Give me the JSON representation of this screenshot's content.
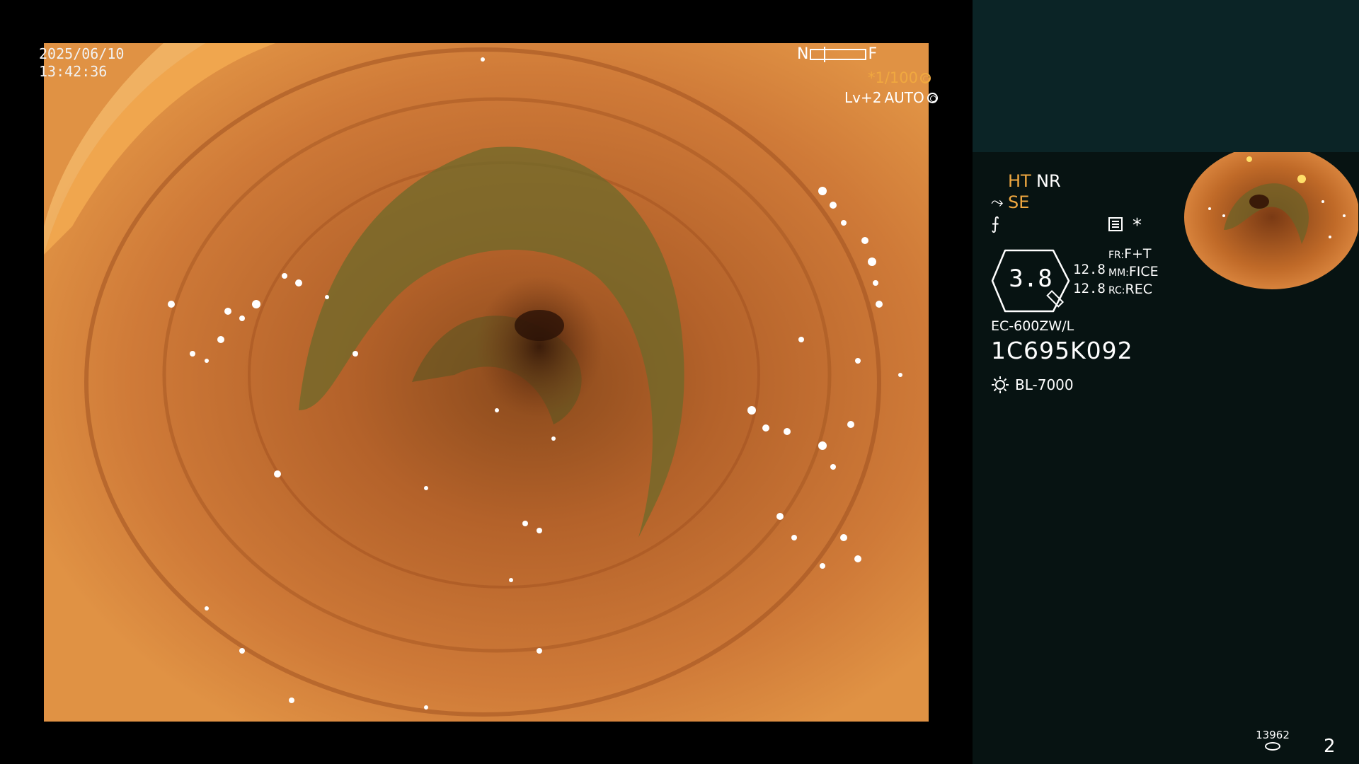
{
  "main_view": {
    "date": "2025/06/10",
    "time": "13:42:36",
    "scale_near": "N",
    "scale_far": "F",
    "shutter": "*1/100",
    "level": "Lv+2",
    "auto": "AUTO"
  },
  "side_panel": {
    "mode_ht": "HT",
    "mode_nr": "NR",
    "mode_se": "SE",
    "zoom": "3.8",
    "value_a": "12.8",
    "value_b": "12.8",
    "fr_key": "FR:",
    "fr_value": "F+T",
    "mm_key": "MM:",
    "mm_value": "FICE",
    "rc_key": "RC:",
    "rc_value": "REC",
    "scope_model": "EC-600ZW/L",
    "serial": "1C695K092",
    "light_source": "BL-7000",
    "image_count": "13962",
    "page_number": "2"
  },
  "colors": {
    "accent_orange": "#f0a840",
    "panel_bg": "#071312",
    "panel_top": "#0b2426",
    "tissue": "#c8702a"
  },
  "icons": [
    "freeze-icon",
    "sun-icon",
    "memo-icon",
    "ring-icon",
    "disk-icon",
    "scope-icon"
  ]
}
